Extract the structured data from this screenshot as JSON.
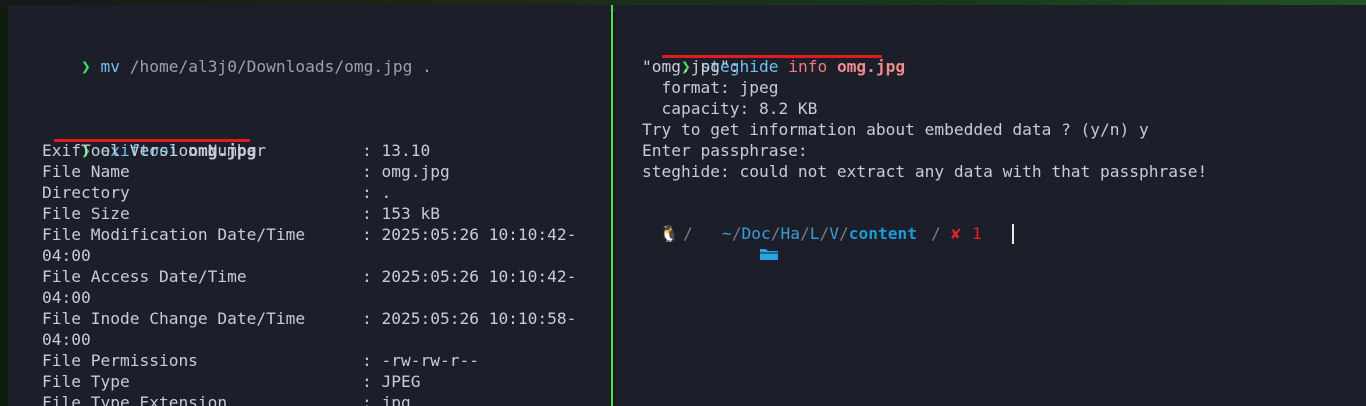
{
  "left_pane": {
    "cmd1": {
      "prompt": "❯",
      "command": "mv",
      "args": "/home/al3j0/Downloads/omg.jpg ."
    },
    "cmd2": {
      "prompt": "❯",
      "command": "exiftool",
      "args": "omg.jpg"
    },
    "exif_rows": [
      {
        "key": "ExifTool Version Number",
        "value": "13.10"
      },
      {
        "key": "File Name",
        "value": "omg.jpg"
      },
      {
        "key": "Directory",
        "value": "."
      },
      {
        "key": "File Size",
        "value": "153 kB"
      },
      {
        "key": "File Modification Date/Time",
        "value": "2025:05:26 10:10:42-",
        "cont": "04:00"
      },
      {
        "key": "File Access Date/Time",
        "value": "2025:05:26 10:10:42-",
        "cont": "04:00"
      },
      {
        "key": "File Inode Change Date/Time",
        "value": "2025:05:26 10:10:58-",
        "cont": "04:00"
      },
      {
        "key": "File Permissions",
        "value": "-rw-rw-r--"
      },
      {
        "key": "File Type",
        "value": "JPEG"
      },
      {
        "key": "File Type Extension",
        "value": "jpg"
      }
    ]
  },
  "right_pane": {
    "cmd": {
      "prompt": "❯",
      "command": "steghide",
      "subcommand": "info",
      "file": "omg.jpg"
    },
    "output": [
      "\"omg.jpg\":",
      "  format: jpeg",
      "  capacity: 8.2 KB",
      "Try to get information about embedded data ? (y/n) y",
      "Enter passphrase:",
      "steghide: could not extract any data with that passphrase!"
    ],
    "status_prompt": {
      "os_icon": "🐧",
      "separator": "/",
      "home": "~",
      "path_parts": [
        "Doc",
        "Ha",
        "L",
        "V"
      ],
      "current_dir": "content",
      "error_icon": "✘",
      "exit_code": "1"
    }
  },
  "colors": {
    "pane_bg": "#1c1e2a",
    "divider": "#4fdc5a",
    "prompt_arrow": "#3fe064",
    "command": "#6fc1ee",
    "underline": "#e01c1c",
    "error": "#e02424"
  }
}
